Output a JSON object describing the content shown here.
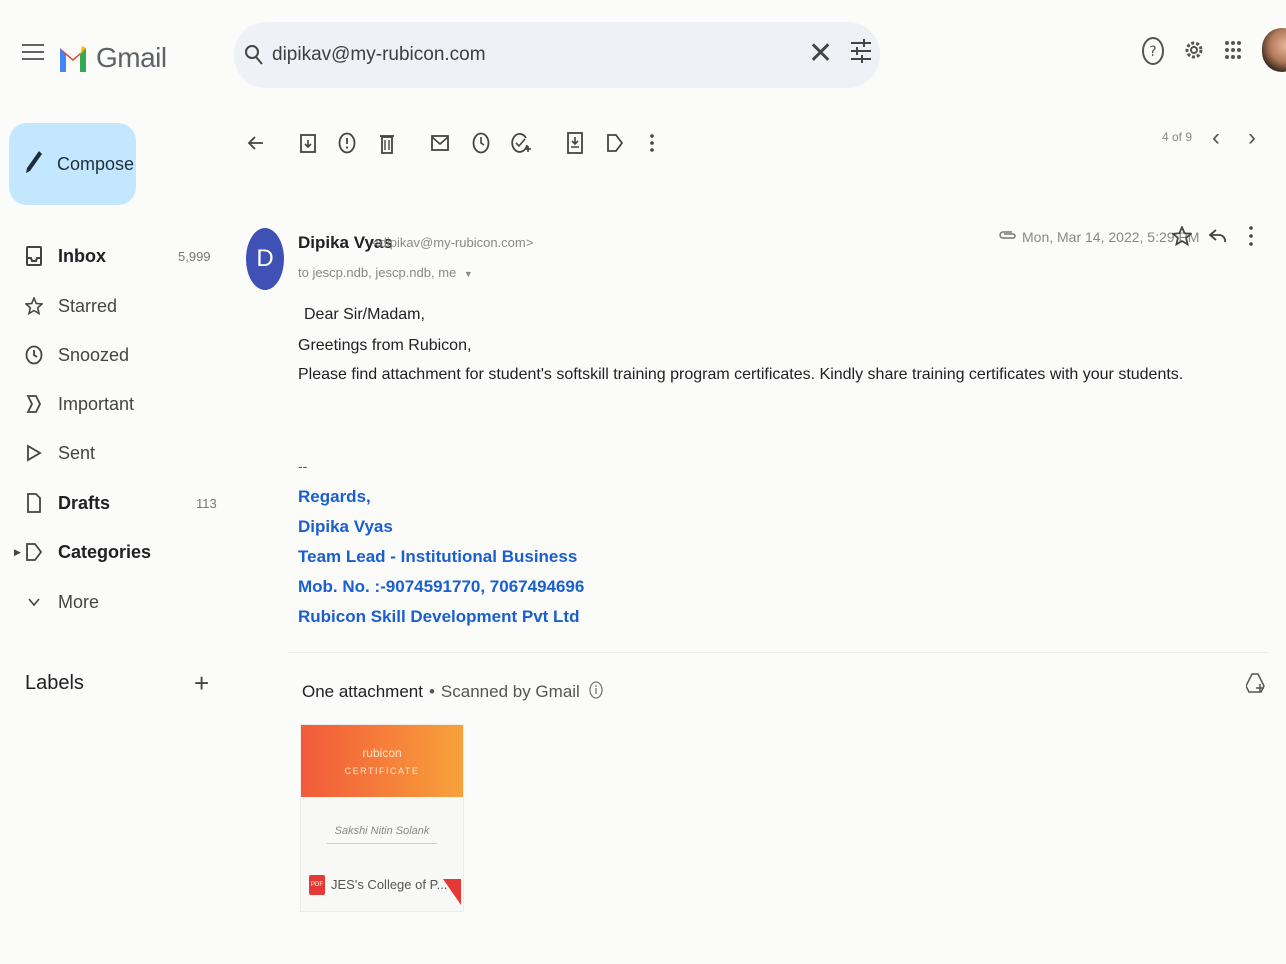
{
  "app": {
    "name": "Gmail"
  },
  "search": {
    "query": "dipikav@my-rubicon.com"
  },
  "sidebar": {
    "compose_label": "Compose",
    "items": [
      {
        "label": "Inbox",
        "count": "5,999",
        "icon": "inbox-icon",
        "bold": true
      },
      {
        "label": "Starred",
        "count": "",
        "icon": "star-icon",
        "bold": false
      },
      {
        "label": "Snoozed",
        "count": "",
        "icon": "clock-icon",
        "bold": false
      },
      {
        "label": "Important",
        "count": "",
        "icon": "important-icon",
        "bold": false
      },
      {
        "label": "Sent",
        "count": "",
        "icon": "send-icon",
        "bold": false
      },
      {
        "label": "Drafts",
        "count": "113",
        "icon": "draft-icon",
        "bold": true
      },
      {
        "label": "Categories",
        "count": "",
        "icon": "label-icon",
        "bold": true
      },
      {
        "label": "More",
        "count": "",
        "icon": "chevron-down-icon",
        "bold": false
      }
    ],
    "labels_heading": "Labels"
  },
  "toolbar": {
    "page_count": "4 of 9"
  },
  "email": {
    "sender_initial": "D",
    "sender_name": "Dipika Vyas",
    "sender_email": "<dipikav@my-rubicon.com>",
    "recipients": "to jescp.ndb, jescp.ndb, me",
    "date": "Mon, Mar 14, 2022, 5:29 PM",
    "body": [
      "Dear Sir/Madam,",
      "Greetings from Rubicon,",
      "Please find attachment for student's softskill training program certificates. Kindly share training certificates with your students."
    ],
    "signature_dash": "--",
    "signature": [
      "Regards,",
      "Dipika Vyas",
      "Team Lead - Institutional Business",
      "Mob. No. :-9074591770, 7067494696",
      "Rubicon Skill Development Pvt Ltd"
    ]
  },
  "attachments": {
    "heading": "One attachment",
    "scanned": "Scanned by Gmail",
    "file": {
      "type_badge": "PDF",
      "name": "JES's College of P...",
      "preview_brand": "rubicon",
      "preview_title": "CERTIFICATE",
      "preview_signature": "Sakshi Nitin Solank"
    }
  },
  "colors": {
    "compose_bg": "#c2e7ff",
    "avatar_bg": "#3f51b5",
    "signature_text": "#1a5fd0",
    "search_bg": "#eef1f5"
  }
}
